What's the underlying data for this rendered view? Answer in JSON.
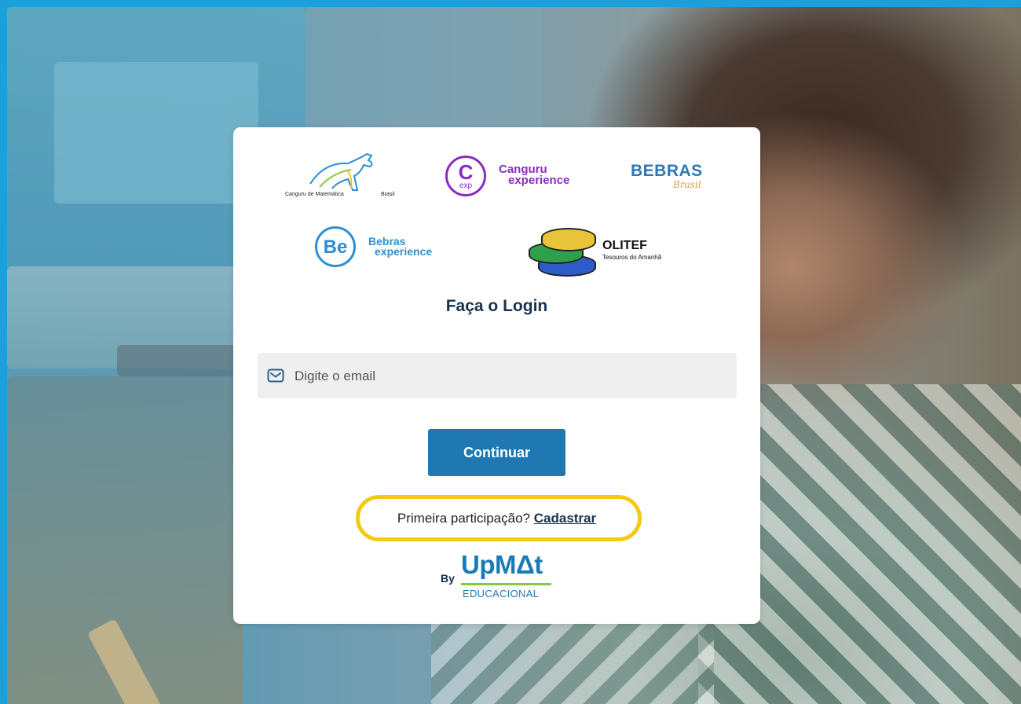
{
  "logos": {
    "canguru_text": "Canguru de Matemática",
    "canguru_country": "Brasil",
    "cexp_badge": "C",
    "cexp_badge_sub": "exp",
    "cexp_line1": "Canguru",
    "cexp_line2": "experience",
    "bebras_line1": "BEBRAS",
    "bebras_line2": "Brasil",
    "beexp_badge": "Be",
    "beexp_line1": "Bebras",
    "beexp_line2": "experience",
    "olitef_line1": "OLITEF",
    "olitef_line2": "Tesouros do Amanhã"
  },
  "login": {
    "title": "Faça o Login",
    "email_placeholder": "Digite o email",
    "email_value": "",
    "continue_label": "Continuar",
    "first_time_text": "Primeira participação?",
    "signup_link": "Cadastrar"
  },
  "brand": {
    "by": "By",
    "name": "UpMΔt",
    "sub": "EDUCACIONAL"
  },
  "colors": {
    "frame": "#1ba0de",
    "primary_button": "#1f78b1",
    "highlight": "#f5c813",
    "title": "#16324f"
  },
  "icons": {
    "email_field": "mail-icon"
  }
}
